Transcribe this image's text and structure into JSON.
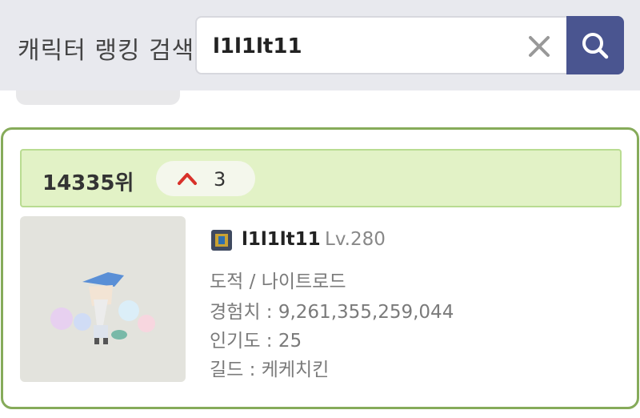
{
  "search": {
    "title": "캐릭터 랭킹 검색",
    "value": "l1l1lt11",
    "clear_icon": "close-icon",
    "button_icon": "search-icon"
  },
  "colors": {
    "accent": "#4a5590",
    "card_border": "#86ab5a",
    "rank_bg": "#e2f2c6",
    "up_arrow": "#d8312a"
  },
  "result": {
    "rank": "14335위",
    "rank_change": "3",
    "rank_change_direction": "up",
    "character": {
      "name": "l1l1lt11",
      "level": "Lv.280",
      "job": "도적 / 나이트로드",
      "exp": "경험치 : 9,261,355,259,044",
      "popularity": "인기도 : 25",
      "guild": "길드 : 케케치킨"
    }
  }
}
